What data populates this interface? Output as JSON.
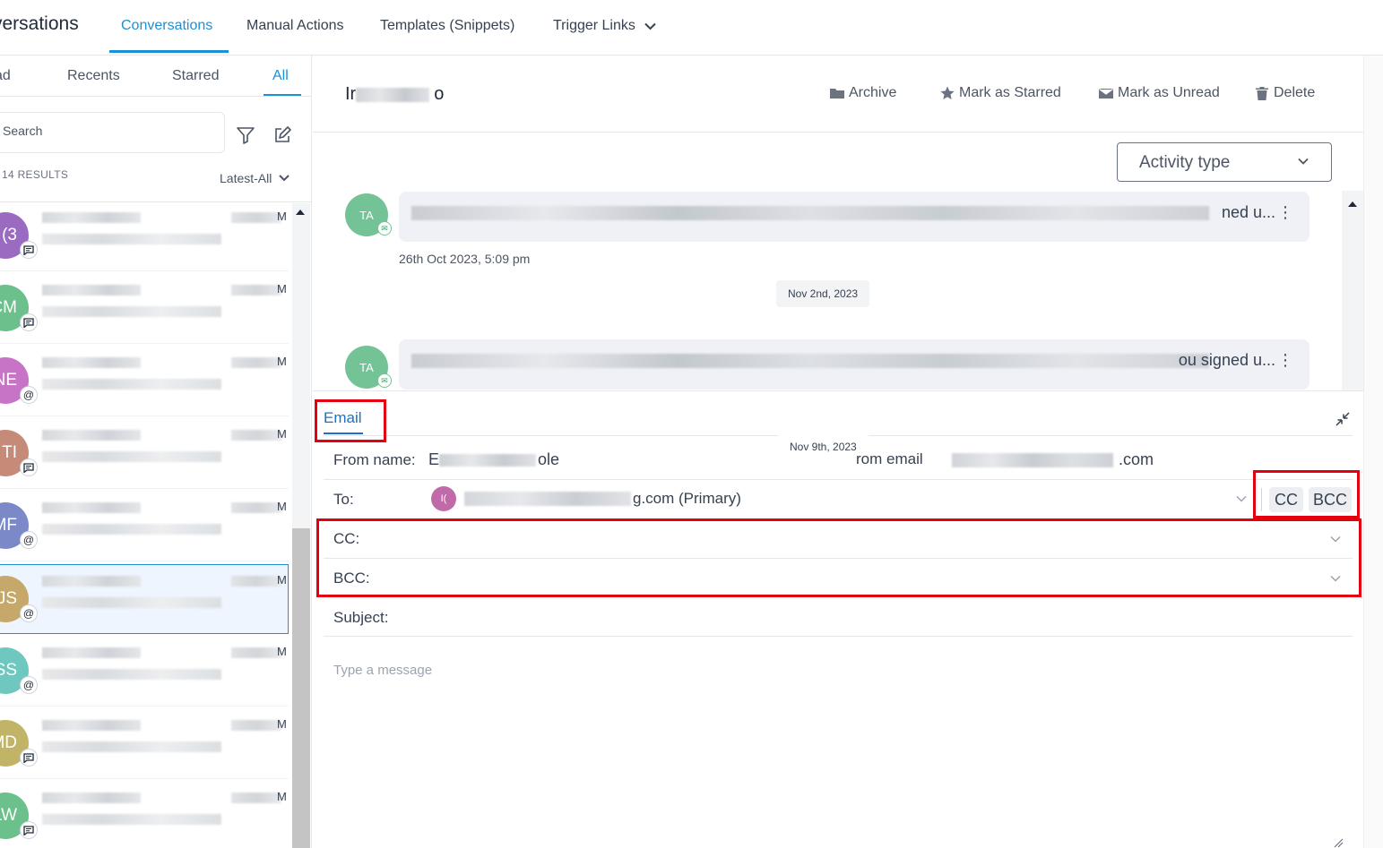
{
  "app": {
    "title": "versations",
    "nav_tabs": [
      {
        "label": "Conversations",
        "active": true
      },
      {
        "label": "Manual Actions",
        "active": false
      },
      {
        "label": "Templates (Snippets)",
        "active": false
      },
      {
        "label": "Trigger Links",
        "active": false
      }
    ]
  },
  "sidebar": {
    "subtabs": [
      {
        "label": "ad",
        "active": false
      },
      {
        "label": "Recents",
        "active": false
      },
      {
        "label": "Starred",
        "active": false
      },
      {
        "label": "All",
        "active": true
      }
    ],
    "search_placeholder": "Search",
    "results_count": "14 RESULTS",
    "sort_label": "Latest-All",
    "conversations": [
      {
        "initials": "(3",
        "color": "#9b6bc2",
        "channel_icon": "chat-icon",
        "time_suffix": "M",
        "selected": false
      },
      {
        "initials": "CM",
        "color": "#6cc08b",
        "channel_icon": "chat-icon",
        "time_suffix": "M",
        "selected": false
      },
      {
        "initials": "NE",
        "color": "#c774c6",
        "channel_icon": "at-icon",
        "time_suffix": "M",
        "selected": false
      },
      {
        "initials": "TI",
        "color": "#c58a78",
        "channel_icon": "chat-icon",
        "time_suffix": "M",
        "selected": false
      },
      {
        "initials": "MF",
        "color": "#7b89c9",
        "channel_icon": "at-icon",
        "time_suffix": "M",
        "selected": false
      },
      {
        "initials": "JS",
        "color": "#c5a86a",
        "channel_icon": "at-icon",
        "time_suffix": "M",
        "selected": true
      },
      {
        "initials": "SS",
        "color": "#6ec8bf",
        "channel_icon": "at-icon",
        "time_suffix": "M",
        "selected": false
      },
      {
        "initials": "MD",
        "color": "#c1b466",
        "channel_icon": "chat-icon",
        "time_suffix": "M",
        "selected": false
      },
      {
        "initials": "LW",
        "color": "#6cc08b",
        "channel_icon": "chat-icon",
        "time_suffix": "M",
        "selected": false
      }
    ]
  },
  "detail": {
    "contact_name_start": "Ir",
    "contact_name_end": "o",
    "actions": {
      "archive": "Archive",
      "star": "Mark as Starred",
      "unread": "Mark as Unread",
      "delete": "Delete"
    },
    "activity_type": "Activity type",
    "messages": [
      {
        "avatar": "TA",
        "preview_tail": "ned u...",
        "timestamp": "26th Oct 2023, 5:09 pm"
      },
      {
        "avatar": "TA",
        "preview_tail": "ou signed u...",
        "timestamp": ""
      }
    ],
    "date_chips": [
      "Nov 2nd, 2023",
      "Nov 9th, 2023"
    ]
  },
  "composer": {
    "tab": "Email",
    "from_name_label": "From name:",
    "from_name_start": "E",
    "from_name_end": "ole",
    "from_email_label": "rom email",
    "from_email_end": ".com",
    "to_label": "To:",
    "to_avatar": "I(",
    "to_value_tail": "g.com (Primary)",
    "cc_toggle": "CC",
    "bcc_toggle": "BCC",
    "cc_label": "CC:",
    "bcc_label": "BCC:",
    "subject_label": "Subject:",
    "message_placeholder": "Type a message"
  }
}
